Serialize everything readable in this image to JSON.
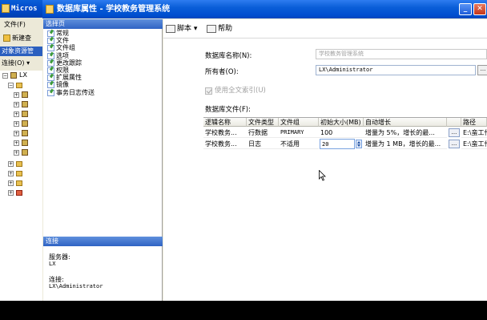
{
  "background_window": {
    "title": "Micros",
    "menu": "文件(F)",
    "toolbar_new": "新建查",
    "object_explorer": "对象资源管",
    "connect": "连接(O) ▾",
    "tree_root": "LX"
  },
  "dialog": {
    "title": "数据库属性 - 学校教务管理系统",
    "select_page_header": "选择页",
    "pages": [
      "常规",
      "文件",
      "文件组",
      "选项",
      "更改跟踪",
      "权限",
      "扩展属性",
      "镜像",
      "事务日志传送"
    ],
    "connection_header": "连接",
    "server_label": "服务器:",
    "server_value": "LX",
    "connection_label": "连接:",
    "connection_value": "LX\\Administrator"
  },
  "toolbar": {
    "script_label": "脚本",
    "help_label": "帮助"
  },
  "form": {
    "db_name_label": "数据库名称(N):",
    "db_name_value": "学校教务管理系统",
    "owner_label": "所有者(O):",
    "owner_value": "LX\\Administrator",
    "fulltext_label": "使用全文索引(U)",
    "files_label": "数据库文件(F):"
  },
  "files_table": {
    "columns": [
      "逻辑名称",
      "文件类型",
      "文件组",
      "初始大小(MB)",
      "自动增长",
      "",
      "路径"
    ],
    "rows": [
      [
        "学校教务...",
        "行数据",
        "PRIMARY",
        "100",
        "增量为 5%，增长的最...",
        "...",
        "E:\\蛮工作"
      ],
      [
        "学校教务...",
        "日志",
        "不适用",
        "20",
        "增量为 1 MB，增长的最...",
        "...",
        "E:\\蛮工作"
      ]
    ]
  },
  "colors": {
    "title_bar": "#0a5ed8",
    "panel_header": "#2f63c4",
    "dialog_bg": "#ece9d8"
  }
}
